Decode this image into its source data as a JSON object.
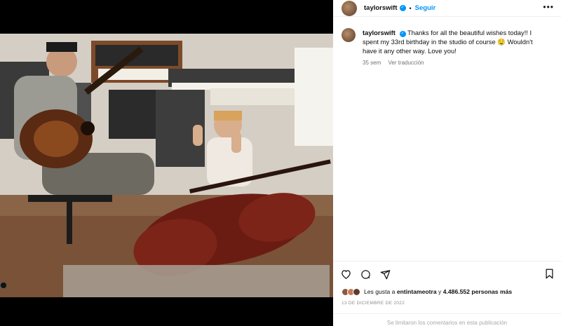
{
  "post": {
    "username": "taylorswift",
    "follow_label": "Seguir",
    "more_label": "•••",
    "caption": "Thanks for all the beautiful wishes today!! I spent my 33rd birthday in the studio of course 🤤 Wouldn't have it any other way. Love you!",
    "age": "35 sem",
    "translate_label": "Ver traducción",
    "likes_prefix": "Les gusta a",
    "likes_user": "entintameotra",
    "likes_mid": "y",
    "likes_count": "4.486.552 personas más",
    "date": "13 DE DICIEMBRE DE 2022",
    "comments_notice": "Se limitaron los comentarios en esta publicación"
  },
  "icons": {
    "like": "heart-icon",
    "comment": "comment-icon",
    "share": "share-icon",
    "save": "bookmark-icon",
    "verified": "verified-badge-icon"
  },
  "colors": {
    "accent": "#0095f6",
    "muted": "#737373"
  }
}
